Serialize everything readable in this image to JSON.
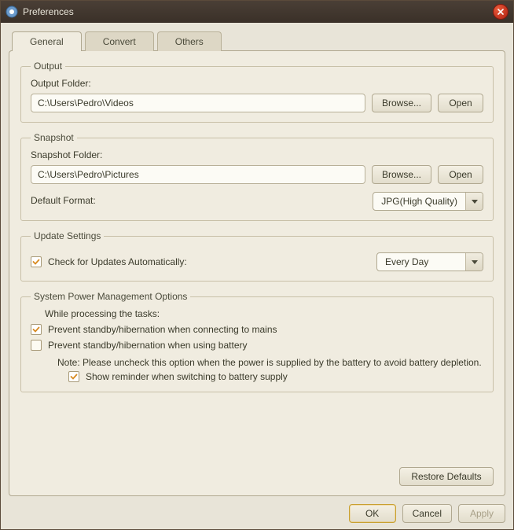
{
  "window": {
    "title": "Preferences"
  },
  "tabs": {
    "general": "General",
    "convert": "Convert",
    "others": "Others"
  },
  "output": {
    "legend": "Output",
    "folder_label": "Output Folder:",
    "folder_value": "C:\\Users\\Pedro\\Videos",
    "browse": "Browse...",
    "open": "Open"
  },
  "snapshot": {
    "legend": "Snapshot",
    "folder_label": "Snapshot Folder:",
    "folder_value": "C:\\Users\\Pedro\\Pictures",
    "browse": "Browse...",
    "open": "Open",
    "format_label": "Default Format:",
    "format_value": "JPG(High Quality)"
  },
  "updates": {
    "legend": "Update Settings",
    "check_label": "Check for Updates Automatically:",
    "frequency": "Every Day"
  },
  "power": {
    "legend": "System Power Management Options",
    "while_processing": "While processing the tasks:",
    "prevent_mains": "Prevent standby/hibernation when connecting to mains",
    "prevent_battery": "Prevent standby/hibernation when using battery",
    "note": "Note: Please uncheck this option when the power is supplied by the battery to avoid battery depletion.",
    "show_reminder": "Show reminder when switching to battery supply"
  },
  "buttons": {
    "restore": "Restore Defaults",
    "ok": "OK",
    "cancel": "Cancel",
    "apply": "Apply"
  }
}
